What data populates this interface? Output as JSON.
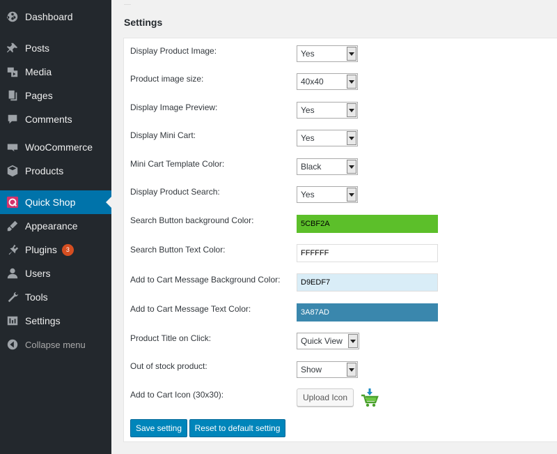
{
  "sidebar": {
    "items": [
      {
        "label": "Dashboard",
        "icon": "dashboard-icon"
      },
      {
        "label": "Posts",
        "icon": "pin-icon"
      },
      {
        "label": "Media",
        "icon": "media-icon"
      },
      {
        "label": "Pages",
        "icon": "pages-icon"
      },
      {
        "label": "Comments",
        "icon": "comments-icon"
      },
      {
        "label": "WooCommerce",
        "icon": "woocommerce-icon"
      },
      {
        "label": "Products",
        "icon": "products-icon"
      },
      {
        "label": "Quick Shop",
        "icon": "quickshop-icon",
        "active": true
      },
      {
        "label": "Appearance",
        "icon": "appearance-icon"
      },
      {
        "label": "Plugins",
        "icon": "plugins-icon",
        "badge": "3"
      },
      {
        "label": "Users",
        "icon": "users-icon"
      },
      {
        "label": "Tools",
        "icon": "tools-icon"
      },
      {
        "label": "Settings",
        "icon": "settings-icon"
      },
      {
        "label": "Collapse menu",
        "icon": "collapse-icon"
      }
    ]
  },
  "page": {
    "title": "Settings"
  },
  "form": {
    "rows": [
      {
        "label": "Display Product Image:",
        "value": "Yes"
      },
      {
        "label": "Product image size:",
        "value": "40x40"
      },
      {
        "label": "Display Image Preview:",
        "value": "Yes"
      },
      {
        "label": "Display Mini Cart:",
        "value": "Yes"
      },
      {
        "label": "Mini Cart Template Color:",
        "value": "Black"
      },
      {
        "label": "Display Product Search:",
        "value": "Yes"
      },
      {
        "label": "Search Button background Color:",
        "value": "5CBF2A",
        "bg": "#5cbf2a"
      },
      {
        "label": "Search Button Text Color:",
        "value": "FFFFFF",
        "bg": "#ffffff"
      },
      {
        "label": "Add to Cart Message Background Color:",
        "value": "D9EDF7",
        "bg": "#d9edf7"
      },
      {
        "label": "Add to Cart Message Text Color:",
        "value": "3A87AD",
        "bg": "#3a87ad"
      },
      {
        "label": "Product Title on Click:",
        "value": "Quick View"
      },
      {
        "label": "Out of stock product:",
        "value": "Show"
      },
      {
        "label": "Add to Cart Icon (30x30):"
      }
    ],
    "upload_label": "Upload Icon",
    "cart_icon": "cart-icon"
  },
  "buttons": {
    "save": "Save setting",
    "reset": "Reset to default setting"
  },
  "colors": {
    "sidebar_bg": "#23282d",
    "active_bg": "#0073aa",
    "primary_btn": "#0085ba"
  }
}
